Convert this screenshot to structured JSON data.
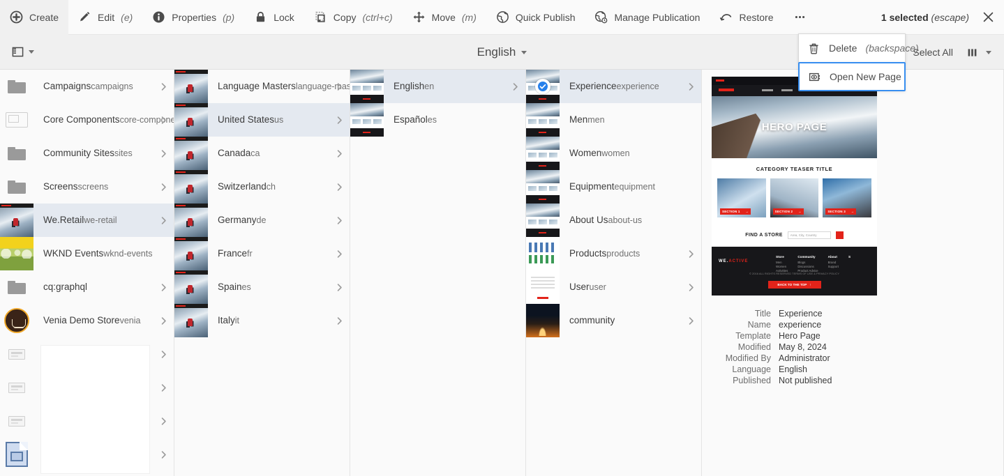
{
  "toolbar": {
    "actions": [
      {
        "icon": "create-icon",
        "label": "Create",
        "shortcut": ""
      },
      {
        "icon": "edit-icon",
        "label": "Edit",
        "shortcut": "(e)"
      },
      {
        "icon": "properties-icon",
        "label": "Properties",
        "shortcut": "(p)"
      },
      {
        "icon": "lock-icon",
        "label": "Lock",
        "shortcut": ""
      },
      {
        "icon": "copy-icon",
        "label": "Copy",
        "shortcut": "(ctrl+c)"
      },
      {
        "icon": "move-icon",
        "label": "Move",
        "shortcut": "(m)"
      },
      {
        "icon": "quick-publish-icon",
        "label": "Quick Publish",
        "shortcut": ""
      },
      {
        "icon": "manage-publication-icon",
        "label": "Manage Publication",
        "shortcut": ""
      },
      {
        "icon": "restore-icon",
        "label": "Restore",
        "shortcut": ""
      },
      {
        "icon": "more-icon",
        "label": "",
        "shortcut": ""
      }
    ],
    "selection_count": "1",
    "selection_label": "selected",
    "selection_shortcut": "(escape)",
    "close_icon": "close-icon"
  },
  "overflow_menu": {
    "items": [
      {
        "icon": "trash-icon",
        "label": "Delete",
        "shortcut": "(backspace)",
        "focused": false
      },
      {
        "icon": "open-page-icon",
        "label": "Open New Page",
        "shortcut": "",
        "focused": true
      }
    ]
  },
  "subbar": {
    "view_switcher_icon": "panel-layout-icon",
    "language_label": "English",
    "select_all_label": "Select All",
    "column_view_icon": "column-view-icon"
  },
  "columns": [
    {
      "name": "sites-root",
      "items": [
        {
          "title": "Campaigns",
          "name": "campaigns",
          "thumb": "folder",
          "chevron": true,
          "state": ""
        },
        {
          "title": "Core Components",
          "name": "core-components-exa...",
          "thumb": "wireframe",
          "chevron": true,
          "state": ""
        },
        {
          "title": "Community Sites",
          "name": "sites",
          "thumb": "folder",
          "chevron": true,
          "state": ""
        },
        {
          "title": "Screens",
          "name": "screens",
          "thumb": "folder",
          "chevron": true,
          "state": ""
        },
        {
          "title": "We.Retail",
          "name": "we-retail",
          "thumb": "retail",
          "chevron": true,
          "state": "selected"
        },
        {
          "title": "WKND Events",
          "name": "wknd-events",
          "thumb": "wknd",
          "chevron": false,
          "state": ""
        },
        {
          "title": "cq:graphql",
          "name": "",
          "thumb": "folder",
          "chevron": true,
          "state": ""
        },
        {
          "title": "Venia Demo Store",
          "name": "venia",
          "thumb": "venia",
          "chevron": true,
          "state": ""
        },
        {
          "title": "",
          "name": "",
          "thumb": "smallpage",
          "chevron": true,
          "state": ""
        },
        {
          "title": "",
          "name": "",
          "thumb": "smallpage",
          "chevron": true,
          "state": ""
        },
        {
          "title": "",
          "name": "",
          "thumb": "smallpage",
          "chevron": true,
          "state": ""
        },
        {
          "title": "",
          "name": "",
          "thumb": "docsel",
          "chevron": true,
          "state": ""
        }
      ]
    },
    {
      "name": "we-retail-children",
      "items": [
        {
          "title": "Language Masters",
          "name": "language-masters",
          "thumb": "retail",
          "chevron": true,
          "state": ""
        },
        {
          "title": "United States",
          "name": "us",
          "thumb": "retail",
          "chevron": true,
          "state": "selected"
        },
        {
          "title": "Canada",
          "name": "ca",
          "thumb": "retail",
          "chevron": true,
          "state": ""
        },
        {
          "title": "Switzerland",
          "name": "ch",
          "thumb": "retail",
          "chevron": true,
          "state": ""
        },
        {
          "title": "Germany",
          "name": "de",
          "thumb": "retail",
          "chevron": true,
          "state": ""
        },
        {
          "title": "France",
          "name": "fr",
          "thumb": "retail",
          "chevron": true,
          "state": ""
        },
        {
          "title": "Spain",
          "name": "es",
          "thumb": "retail",
          "chevron": true,
          "state": ""
        },
        {
          "title": "Italy",
          "name": "it",
          "thumb": "retail",
          "chevron": true,
          "state": ""
        }
      ]
    },
    {
      "name": "us-children",
      "items": [
        {
          "title": "English",
          "name": "en",
          "thumb": "site",
          "chevron": true,
          "state": "selected"
        },
        {
          "title": "Español",
          "name": "es",
          "thumb": "site",
          "chevron": false,
          "state": ""
        }
      ]
    },
    {
      "name": "en-children",
      "items": [
        {
          "title": "Experience",
          "name": "experience",
          "thumb": "site",
          "chevron": true,
          "state": "selected",
          "checked": true
        },
        {
          "title": "Men",
          "name": "men",
          "thumb": "site",
          "chevron": false,
          "state": ""
        },
        {
          "title": "Women",
          "name": "women",
          "thumb": "site",
          "chevron": false,
          "state": ""
        },
        {
          "title": "Equipment",
          "name": "equipment",
          "thumb": "site",
          "chevron": false,
          "state": ""
        },
        {
          "title": "About Us",
          "name": "about-us",
          "thumb": "site",
          "chevron": false,
          "state": ""
        },
        {
          "title": "Products",
          "name": "products",
          "thumb": "grid",
          "chevron": true,
          "state": ""
        },
        {
          "title": "User",
          "name": "user",
          "thumb": "form",
          "chevron": true,
          "state": ""
        },
        {
          "title": "community",
          "name": "",
          "thumb": "night",
          "chevron": true,
          "state": ""
        }
      ]
    }
  ],
  "preview": {
    "page": {
      "hero_title": "HERO PAGE",
      "teaser_title": "CATEGORY TEASER TITLE",
      "teaser_cards": [
        {
          "label": "SECTION 1",
          "arrow": "→"
        },
        {
          "label": "SECTION 2",
          "arrow": "→"
        },
        {
          "label": "SECTION 3",
          "arrow": "→"
        }
      ],
      "find_store_label": "FIND A STORE",
      "find_store_placeholder": "Area, City, Country",
      "footer_brand_pre": "WE.",
      "footer_brand_post": "ACTIVE",
      "footer_columns": [
        {
          "heading": "Store",
          "items": "Men\nWomen\nActivities"
        },
        {
          "heading": "Community",
          "items": "Blogs\nDiscussions\nProduct Advice"
        },
        {
          "heading": "About",
          "items": "Brand\nSupport"
        },
        {
          "heading": "S",
          "items": ""
        }
      ],
      "footer_legal": "© 2016 ALL RIGHTS RESERVED    TERMS OF USE & PRIVACY POLICY",
      "back_to_top": "BACK TO THE TOP",
      "back_to_top_arrow": "↑"
    },
    "metadata": [
      {
        "key": "Title",
        "value": "Experience"
      },
      {
        "key": "Name",
        "value": "experience"
      },
      {
        "key": "Template",
        "value": "Hero Page"
      },
      {
        "key": "Modified",
        "value": "May 8, 2024"
      },
      {
        "key": "Modified By",
        "value": "Administrator"
      },
      {
        "key": "Language",
        "value": "English"
      },
      {
        "key": "Published",
        "value": "Not published"
      }
    ]
  },
  "colors": {
    "accent": "#378ef0",
    "brand_red": "#e2231a",
    "selected_row": "#e4e9f0",
    "bg": "#fafafa"
  }
}
